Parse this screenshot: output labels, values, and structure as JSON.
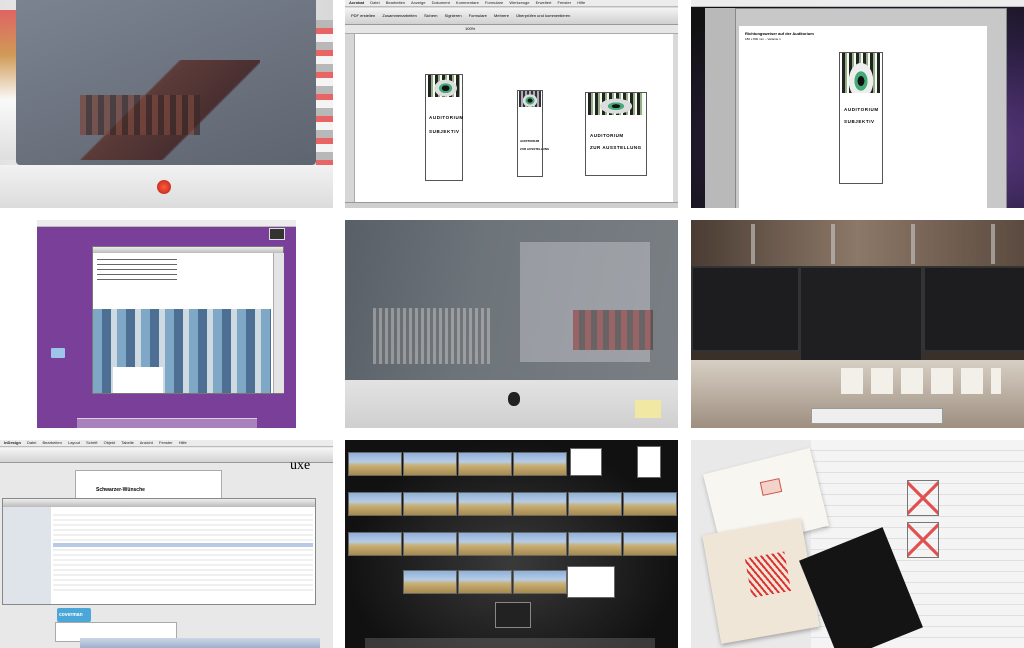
{
  "tile2": {
    "menu": [
      "Acrobat",
      "Datei",
      "Bearbeiten",
      "Anzeige",
      "Dokument",
      "Kommentare",
      "Formulare",
      "Werkzeuge",
      "Erweitert",
      "Fenster",
      "Hilfe"
    ],
    "toolbar": [
      "PDF erstellen",
      "Zusammenarbeiten",
      "Sichern",
      "Signieren",
      "Formulare",
      "Mehrere",
      "Überprüfen und kommentieren"
    ],
    "zoom": "100%",
    "panels": [
      {
        "lines": [
          "AUDITORIUM",
          "SUBJEKTIV"
        ]
      },
      {
        "lines": [
          "AUDITORIUM",
          "ZUR AUSSTELLUNG"
        ]
      },
      {
        "lines": [
          "AUDITORIUM",
          "ZUR AUSSTELLUNG"
        ]
      }
    ]
  },
  "tile3": {
    "heading": "Richtungsweiser auf der Auditorium",
    "sub": "186 x 800 mm – Variante 1",
    "lines": [
      "AUDITORIUM",
      "SUBJEKTIV"
    ]
  },
  "tile7": {
    "menu": [
      "InDesign",
      "Datei",
      "Bearbeiten",
      "Layout",
      "Schrift",
      "Objekt",
      "Tabelle",
      "Ansicht",
      "Fenster",
      "Hilfe"
    ],
    "doc_title": "Schwarzer-Wünsche",
    "big_text": "uxe",
    "badge": "coverman"
  }
}
